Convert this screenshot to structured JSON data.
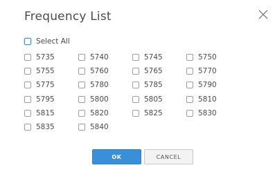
{
  "dialog": {
    "title": "Frequency List",
    "close_icon": "close-icon"
  },
  "select_all": {
    "label": "Select All",
    "checked": false
  },
  "frequencies": [
    "5735",
    "5740",
    "5745",
    "5750",
    "5755",
    "5760",
    "5765",
    "5770",
    "5775",
    "5780",
    "5785",
    "5790",
    "5795",
    "5800",
    "5805",
    "5810",
    "5815",
    "5820",
    "5825",
    "5830",
    "5835",
    "5840"
  ],
  "buttons": {
    "ok_label": "OK",
    "cancel_label": "CANCEL"
  },
  "colors": {
    "accent": "#3a8fd9",
    "text": "#4a4a4a"
  }
}
